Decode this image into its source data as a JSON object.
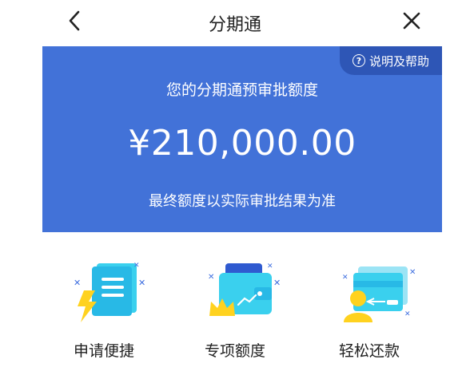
{
  "nav": {
    "title": "分期通",
    "back_icon": "chevron-left-icon",
    "close_icon": "close-icon"
  },
  "card": {
    "help_label": "说明及帮助",
    "help_icon_glyph": "?",
    "label": "您的分期通预审批额度",
    "amount": "¥210,000.00",
    "note": "最终额度以实际审批结果为准",
    "background_color": "#4272d8"
  },
  "features": [
    {
      "label": "申请便捷",
      "icon": "receipt-lightning-icon"
    },
    {
      "label": "专项额度",
      "icon": "wallet-crown-icon"
    },
    {
      "label": "轻松还款",
      "icon": "card-user-icon"
    }
  ],
  "colors": {
    "accent_blue": "#4272d8",
    "icon_cyan": "#3ad0ee",
    "icon_yellow": "#ffd21f"
  }
}
